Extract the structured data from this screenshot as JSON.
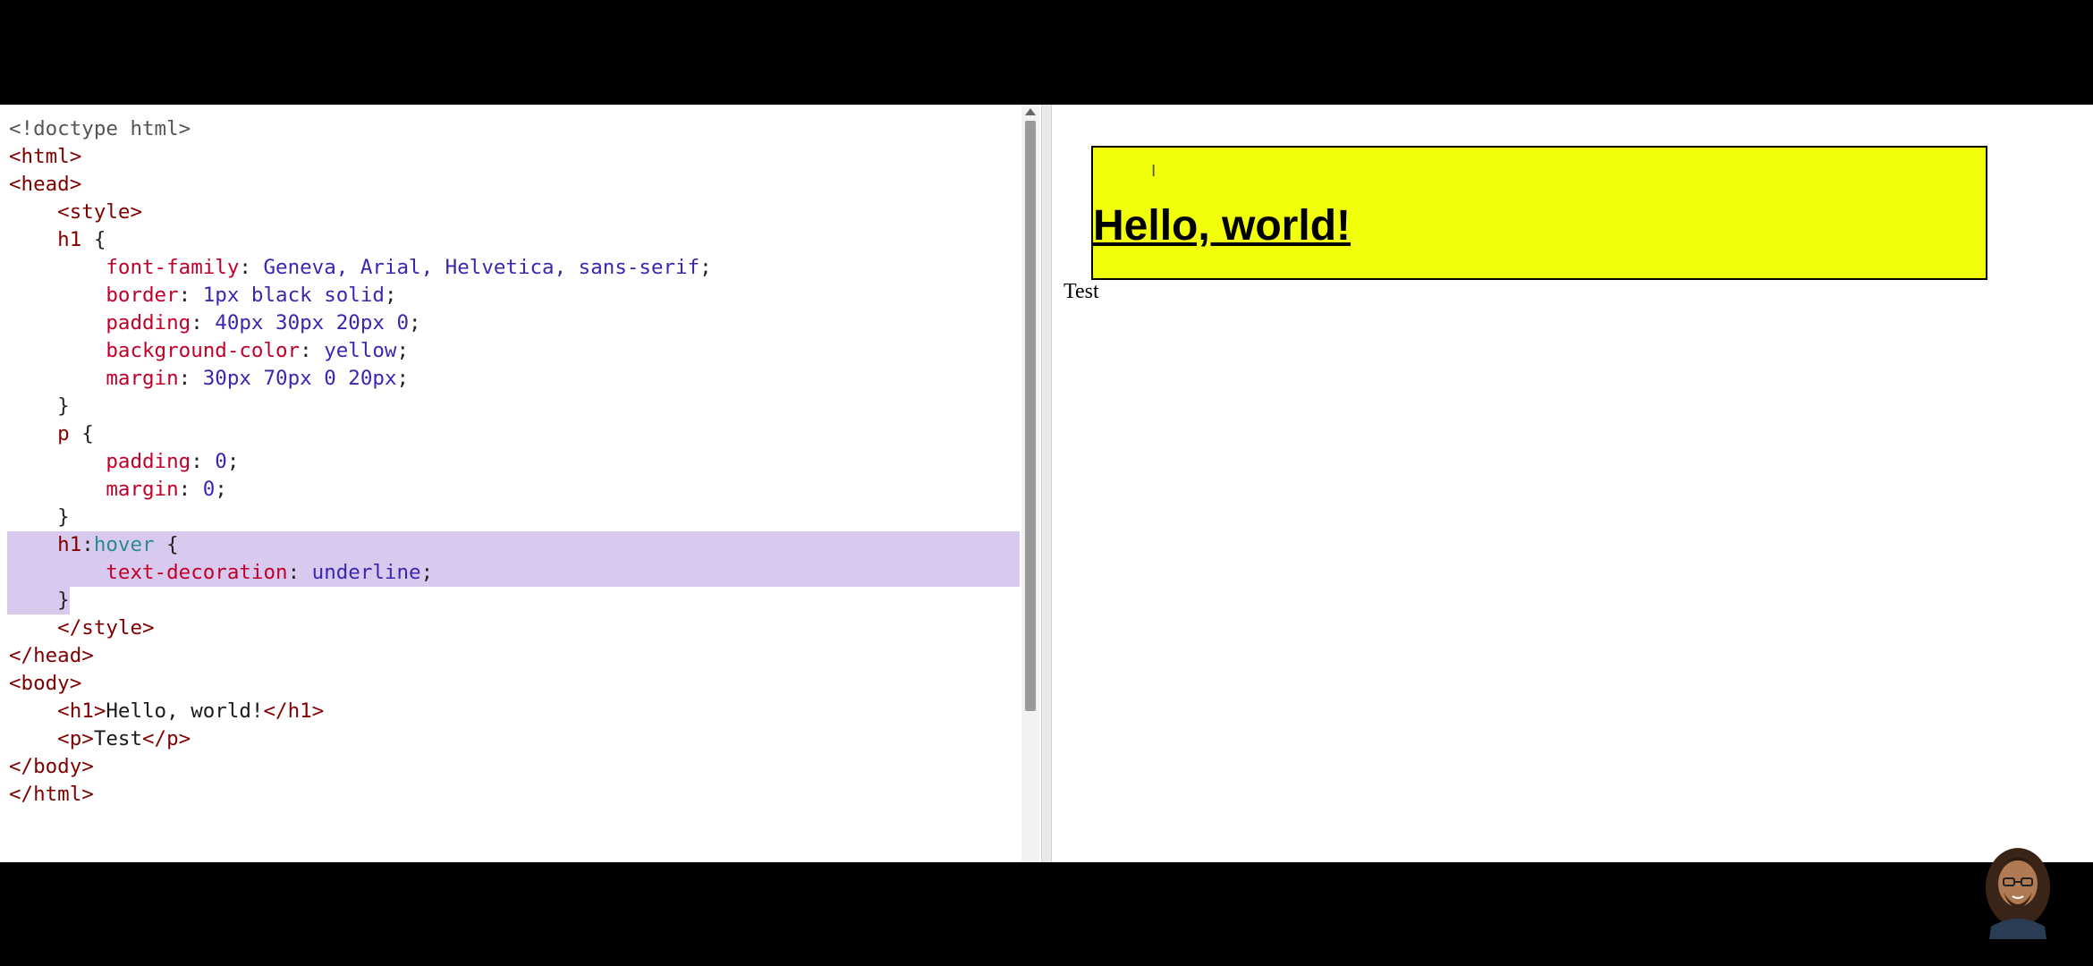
{
  "editor": {
    "lines": [
      {
        "parts": [
          {
            "c": "doc",
            "t": "<!doctype html>"
          }
        ]
      },
      {
        "parts": [
          {
            "c": "tag",
            "t": "<html>"
          }
        ]
      },
      {
        "parts": [
          {
            "c": "tag",
            "t": "<head>"
          }
        ]
      },
      {
        "parts": [
          {
            "c": "tag",
            "t": "    <style>"
          }
        ]
      },
      {
        "parts": [
          {
            "c": "sel",
            "t": "    h1 "
          },
          {
            "c": "punc",
            "t": "{"
          }
        ]
      },
      {
        "parts": [
          {
            "c": "prop",
            "t": "        font-family"
          },
          {
            "c": "punc",
            "t": ": "
          },
          {
            "c": "val",
            "t": "Geneva, Arial, Helvetica, sans-serif"
          },
          {
            "c": "punc",
            "t": ";"
          }
        ]
      },
      {
        "parts": [
          {
            "c": "prop",
            "t": "        border"
          },
          {
            "c": "punc",
            "t": ": "
          },
          {
            "c": "val",
            "t": "1px black solid"
          },
          {
            "c": "punc",
            "t": ";"
          }
        ]
      },
      {
        "parts": [
          {
            "c": "prop",
            "t": "        padding"
          },
          {
            "c": "punc",
            "t": ": "
          },
          {
            "c": "val",
            "t": "40px 30px 20px 0"
          },
          {
            "c": "punc",
            "t": ";"
          }
        ]
      },
      {
        "parts": [
          {
            "c": "prop",
            "t": "        background-color"
          },
          {
            "c": "punc",
            "t": ": "
          },
          {
            "c": "val",
            "t": "yellow"
          },
          {
            "c": "punc",
            "t": ";"
          }
        ]
      },
      {
        "parts": [
          {
            "c": "prop",
            "t": "        margin"
          },
          {
            "c": "punc",
            "t": ": "
          },
          {
            "c": "val",
            "t": "30px 70px 0 20px"
          },
          {
            "c": "punc",
            "t": ";"
          }
        ]
      },
      {
        "parts": [
          {
            "c": "punc",
            "t": "    }"
          }
        ]
      },
      {
        "parts": [
          {
            "c": "sel",
            "t": "    p "
          },
          {
            "c": "punc",
            "t": "{"
          }
        ]
      },
      {
        "parts": [
          {
            "c": "prop",
            "t": "        padding"
          },
          {
            "c": "punc",
            "t": ": "
          },
          {
            "c": "val",
            "t": "0"
          },
          {
            "c": "punc",
            "t": ";"
          }
        ]
      },
      {
        "parts": [
          {
            "c": "prop",
            "t": "        margin"
          },
          {
            "c": "punc",
            "t": ": "
          },
          {
            "c": "val",
            "t": "0"
          },
          {
            "c": "punc",
            "t": ";"
          }
        ]
      },
      {
        "parts": [
          {
            "c": "punc",
            "t": "    }"
          }
        ]
      },
      {
        "sel": "full",
        "parts": [
          {
            "c": "sel",
            "t": "    h1"
          },
          {
            "c": "punc",
            "t": ":"
          },
          {
            "c": "pseudo",
            "t": "hover"
          },
          {
            "c": "punc",
            "t": " {"
          }
        ]
      },
      {
        "sel": "full",
        "parts": [
          {
            "c": "prop",
            "t": "        text-decoration"
          },
          {
            "c": "punc",
            "t": ": "
          },
          {
            "c": "val",
            "t": "underline"
          },
          {
            "c": "punc",
            "t": ";"
          }
        ]
      },
      {
        "sel": "short",
        "parts": [
          {
            "c": "punc",
            "t": "    }"
          }
        ]
      },
      {
        "parts": [
          {
            "c": "tag",
            "t": "    </style>"
          }
        ]
      },
      {
        "parts": [
          {
            "c": "tag",
            "t": "</head>"
          }
        ]
      },
      {
        "parts": [
          {
            "c": "tag",
            "t": "<body>"
          }
        ]
      },
      {
        "parts": [
          {
            "c": "tag",
            "t": "    <h1>"
          },
          {
            "c": "txt",
            "t": "Hello, world!"
          },
          {
            "c": "tag",
            "t": "</h1>"
          }
        ]
      },
      {
        "parts": [
          {
            "c": "tag",
            "t": "    <p>"
          },
          {
            "c": "txt",
            "t": "Test"
          },
          {
            "c": "tag",
            "t": "</p>"
          }
        ]
      },
      {
        "parts": [
          {
            "c": "tag",
            "t": "</body>"
          }
        ]
      },
      {
        "parts": [
          {
            "c": "tag",
            "t": "</html>"
          }
        ]
      }
    ]
  },
  "preview": {
    "heading": "Hello, world!",
    "paragraph": "Test",
    "heading_bg": "#f2ff0a"
  },
  "icons": {
    "cursor": "text-cursor-icon",
    "avatar": "presenter-avatar"
  }
}
